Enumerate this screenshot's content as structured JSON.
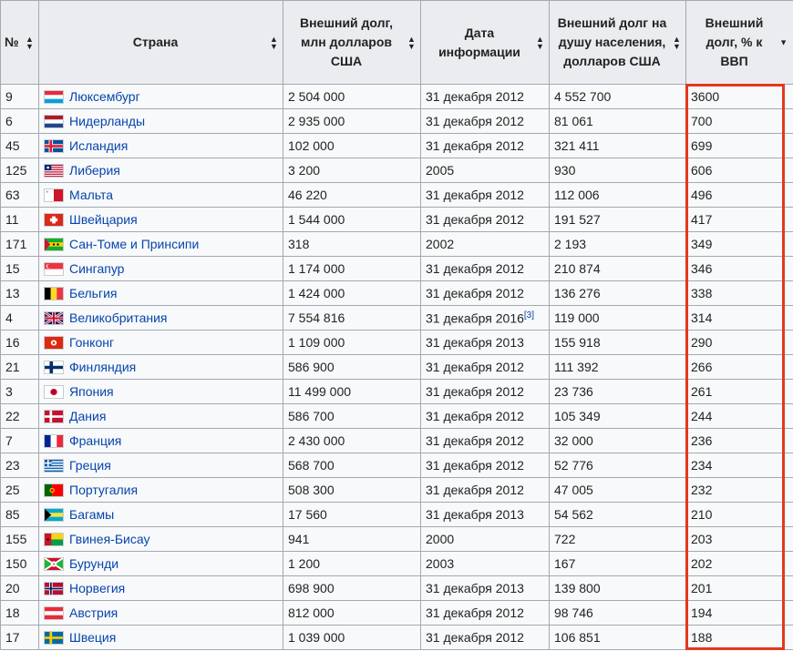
{
  "headers": {
    "num": "№",
    "country": "Страна",
    "debt": "Внешний долг, млн долларов США",
    "date": "Дата информации",
    "per_capita": "Внешний долг на душу населения, долларов США",
    "gdp": "Внешний долг, % к ВВП"
  },
  "highlight_color": "#e3381d",
  "link_color": "#0645ad",
  "rows": [
    {
      "num": "9",
      "country": "Люксембург",
      "flag": "luxembourg-flag-icon",
      "debt": "2 504 000",
      "date": "31 декабря 2012",
      "ref": "",
      "per_capita": "4 552 700",
      "gdp": "3600"
    },
    {
      "num": "6",
      "country": "Нидерланды",
      "flag": "netherlands-flag-icon",
      "debt": "2 935 000",
      "date": "31 декабря 2012",
      "ref": "",
      "per_capita": "81 061",
      "gdp": "700"
    },
    {
      "num": "45",
      "country": "Исландия",
      "flag": "iceland-flag-icon",
      "debt": "102 000",
      "date": "31 декабря 2012",
      "ref": "",
      "per_capita": "321 411",
      "gdp": "699"
    },
    {
      "num": "125",
      "country": "Либерия",
      "flag": "liberia-flag-icon",
      "debt": "3 200",
      "date": "2005",
      "ref": "",
      "per_capita": "930",
      "gdp": "606"
    },
    {
      "num": "63",
      "country": "Мальта",
      "flag": "malta-flag-icon",
      "debt": "46 220",
      "date": "31 декабря 2012",
      "ref": "",
      "per_capita": "112 006",
      "gdp": "496"
    },
    {
      "num": "11",
      "country": "Швейцария",
      "flag": "switzerland-flag-icon",
      "debt": "1 544 000",
      "date": "31 декабря 2012",
      "ref": "",
      "per_capita": "191 527",
      "gdp": "417"
    },
    {
      "num": "171",
      "country": "Сан-Томе и Принсипи",
      "flag": "sao-tome-flag-icon",
      "debt": "318",
      "date": "2002",
      "ref": "",
      "per_capita": "2 193",
      "gdp": "349"
    },
    {
      "num": "15",
      "country": "Сингапур",
      "flag": "singapore-flag-icon",
      "debt": "1 174 000",
      "date": "31 декабря 2012",
      "ref": "",
      "per_capita": "210 874",
      "gdp": "346"
    },
    {
      "num": "13",
      "country": "Бельгия",
      "flag": "belgium-flag-icon",
      "debt": "1 424 000",
      "date": "31 декабря 2012",
      "ref": "",
      "per_capita": "136 276",
      "gdp": "338"
    },
    {
      "num": "4",
      "country": "Великобритания",
      "flag": "uk-flag-icon",
      "debt": "7 554 816",
      "date": "31 декабря 2016",
      "ref": "[3]",
      "per_capita": "119 000",
      "gdp": "314"
    },
    {
      "num": "16",
      "country": "Гонконг",
      "flag": "hong-kong-flag-icon",
      "debt": "1 109 000",
      "date": "31 декабря 2013",
      "ref": "",
      "per_capita": "155 918",
      "gdp": "290"
    },
    {
      "num": "21",
      "country": "Финляндия",
      "flag": "finland-flag-icon",
      "debt": "586 900",
      "date": "31 декабря 2012",
      "ref": "",
      "per_capita": "111 392",
      "gdp": "266"
    },
    {
      "num": "3",
      "country": "Япония",
      "flag": "japan-flag-icon",
      "debt": "11 499 000",
      "date": "31 декабря 2012",
      "ref": "",
      "per_capita": "23 736",
      "gdp": "261"
    },
    {
      "num": "22",
      "country": "Дания",
      "flag": "denmark-flag-icon",
      "debt": "586 700",
      "date": "31 декабря 2012",
      "ref": "",
      "per_capita": "105 349",
      "gdp": "244"
    },
    {
      "num": "7",
      "country": "Франция",
      "flag": "france-flag-icon",
      "debt": "2 430 000",
      "date": "31 декабря 2012",
      "ref": "",
      "per_capita": "32 000",
      "gdp": "236"
    },
    {
      "num": "23",
      "country": "Греция",
      "flag": "greece-flag-icon",
      "debt": "568 700",
      "date": "31 декабря 2012",
      "ref": "",
      "per_capita": "52 776",
      "gdp": "234"
    },
    {
      "num": "25",
      "country": "Португалия",
      "flag": "portugal-flag-icon",
      "debt": "508 300",
      "date": "31 декабря 2012",
      "ref": "",
      "per_capita": "47 005",
      "gdp": "232"
    },
    {
      "num": "85",
      "country": "Багамы",
      "flag": "bahamas-flag-icon",
      "debt": "17 560",
      "date": "31 декабря 2013",
      "ref": "",
      "per_capita": "54 562",
      "gdp": "210"
    },
    {
      "num": "155",
      "country": "Гвинея-Бисау",
      "flag": "guinea-bissau-flag-icon",
      "debt": "941",
      "date": "2000",
      "ref": "",
      "per_capita": "722",
      "gdp": "203"
    },
    {
      "num": "150",
      "country": "Бурунди",
      "flag": "burundi-flag-icon",
      "debt": "1 200",
      "date": "2003",
      "ref": "",
      "per_capita": "167",
      "gdp": "202"
    },
    {
      "num": "20",
      "country": "Норвегия",
      "flag": "norway-flag-icon",
      "debt": "698 900",
      "date": "31 декабря 2013",
      "ref": "",
      "per_capita": "139 800",
      "gdp": "201"
    },
    {
      "num": "18",
      "country": "Австрия",
      "flag": "austria-flag-icon",
      "debt": "812 000",
      "date": "31 декабря 2012",
      "ref": "",
      "per_capita": "98 746",
      "gdp": "194"
    },
    {
      "num": "17",
      "country": "Швеция",
      "flag": "sweden-flag-icon",
      "debt": "1 039 000",
      "date": "31 декабря 2012",
      "ref": "",
      "per_capita": "106 851",
      "gdp": "188"
    }
  ]
}
